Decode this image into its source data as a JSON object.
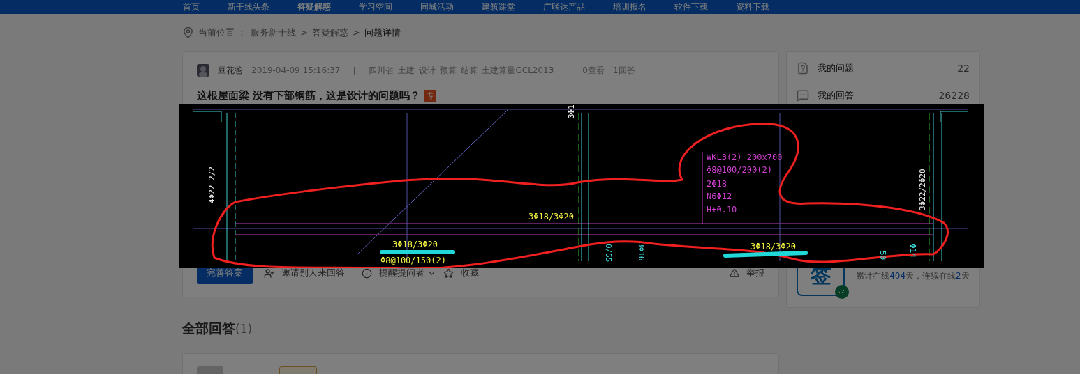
{
  "nav": {
    "items": [
      {
        "label": "首页",
        "selected": false
      },
      {
        "label": "新干线头条",
        "selected": false
      },
      {
        "label": "答疑解惑",
        "selected": true
      },
      {
        "label": "学习空间",
        "selected": false
      },
      {
        "label": "同城活动",
        "selected": false
      },
      {
        "label": "建筑课堂",
        "selected": false
      },
      {
        "label": "广联达产品",
        "selected": false
      },
      {
        "label": "培训报名",
        "selected": false
      },
      {
        "label": "软件下载",
        "selected": false
      },
      {
        "label": "资料下载",
        "selected": false
      }
    ]
  },
  "breadcrumb": {
    "label": "当前位置 ：",
    "separator": ">",
    "items": [
      "服务新干线",
      "答疑解惑",
      "问题详情"
    ]
  },
  "question": {
    "author": "豆花爸",
    "time": "2019-04-09 15:16:37",
    "location": "四川省",
    "tags": [
      "土建",
      "设计",
      "预算",
      "结算",
      "土建算量GCL2013"
    ],
    "views": "0查看",
    "answers": "1回答",
    "title": "这根屋面梁 没有下部钢筋，这是设计的问题吗？",
    "badge": "专"
  },
  "actions": {
    "primary": "完善答案",
    "invite": "邀请别人来回答",
    "remind": "提醒提问者",
    "favorite": "收藏",
    "report": "举报"
  },
  "answers_heading": {
    "label": "全部回答",
    "count": "(1)"
  },
  "sidebar": {
    "stats": [
      {
        "kind": "question",
        "label": "我的问题",
        "count": "22"
      },
      {
        "kind": "answer",
        "label": "我的回答",
        "count": "26228"
      }
    ],
    "sign": {
      "glyph": "签",
      "checked": true,
      "text": [
        {
          "text": "累计在线",
          "highlight": false
        },
        {
          "text": "404",
          "highlight": true
        },
        {
          "text": "天，连续在线",
          "highlight": false
        },
        {
          "text": "2",
          "highlight": true
        },
        {
          "text": "天",
          "highlight": false
        }
      ]
    }
  },
  "lightbox": {
    "beam_notes": [
      "WKL3(2) 200x700",
      "Φ8@100/200(2)",
      "2Φ18",
      "N6Φ12",
      "H+0.10"
    ],
    "rebar_labels": [
      "3Φ18/3Φ20",
      "3Φ18/3Φ20",
      "3Φ18/3Φ20"
    ],
    "stirrup_label": "Φ8@100/150(2)",
    "column_labels": [
      "4Φ22 2/2",
      "3Φ22/2Φ20",
      "3Φ1"
    ],
    "cyan_labels": [
      "0/55",
      "3Φ16",
      "50",
      "Φ14"
    ]
  }
}
